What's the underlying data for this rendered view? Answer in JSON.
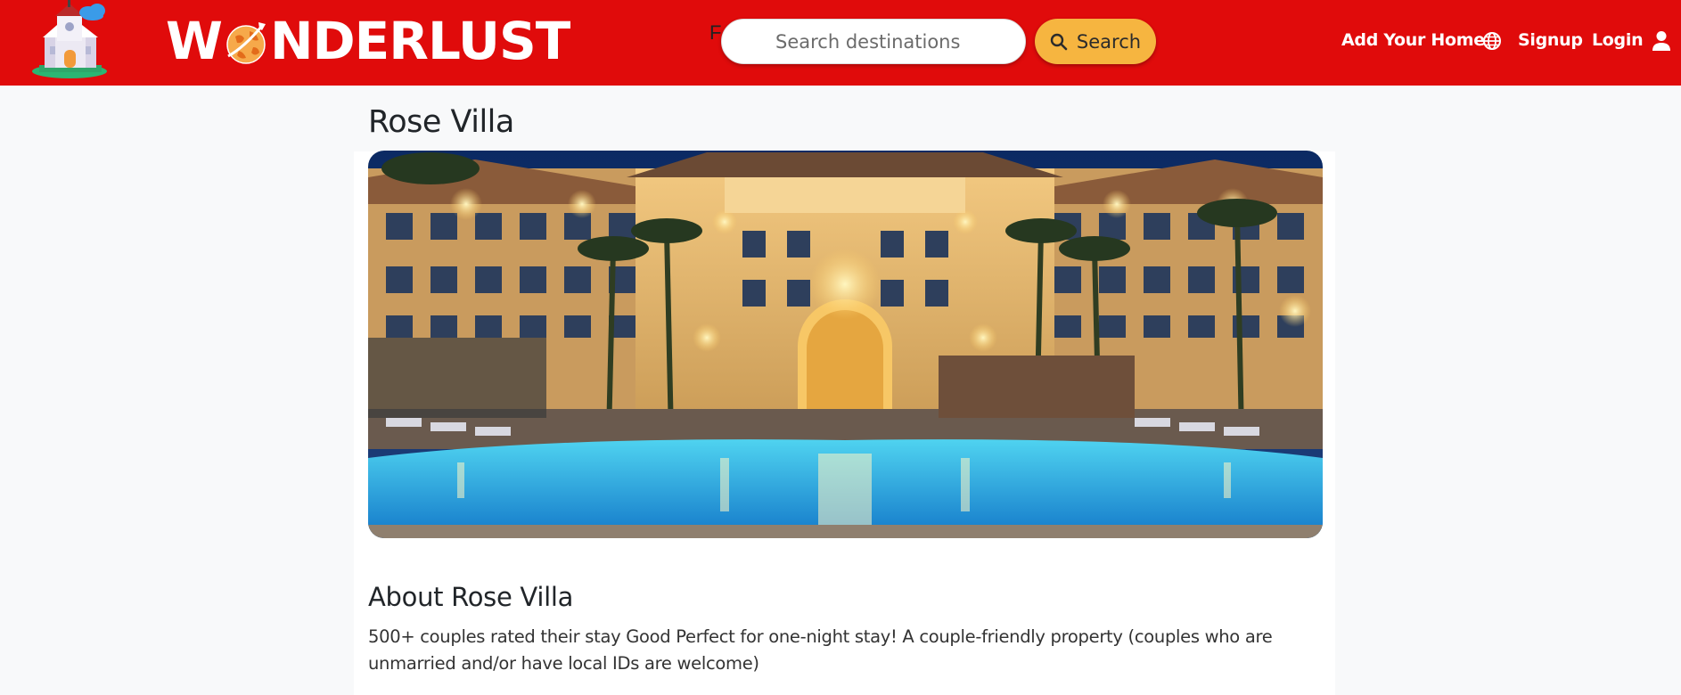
{
  "navbar": {
    "brand": "WONDERLUST",
    "stray_char": "F",
    "search": {
      "placeholder": "Search destinations",
      "button_label": "Search"
    },
    "links": {
      "add_home": "Add Your Home",
      "signup": "Signup",
      "login": "Login"
    },
    "icons": {
      "logo": "castle-logo-icon",
      "globe": "globe-icon",
      "user": "user-icon",
      "search": "search-icon"
    },
    "colors": {
      "background": "#e00b0b",
      "search_button": "#f6b540"
    }
  },
  "listing": {
    "title": "Rose Villa",
    "image_alt": "hotel-pool-night-image",
    "about_heading": "About Rose Villa",
    "about_text": "500+ couples rated their stay Good Perfect for one-night stay! A couple-friendly property (couples who are unmarried and/or have local IDs are welcome)"
  }
}
